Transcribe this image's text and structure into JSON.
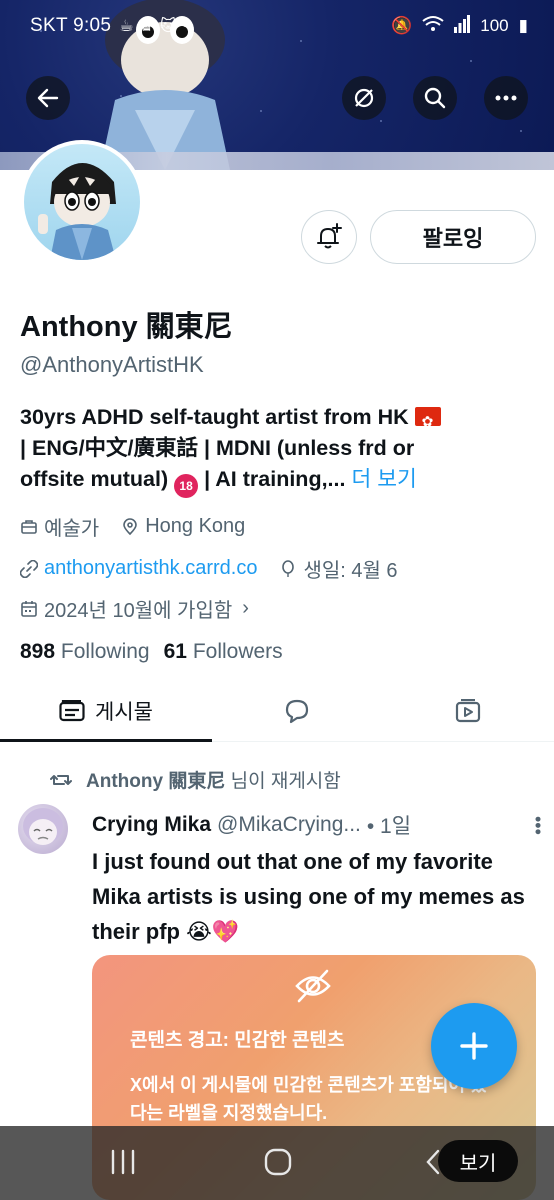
{
  "status_bar": {
    "time": "SKT 9:05",
    "battery": "100"
  },
  "profile": {
    "name": "Anthony 關東尼",
    "handle": "@AnthonyArtistHK",
    "bio_line1": "30yrs ADHD self-taught artist from HK",
    "bio_line2": "| ENG/中文/廣東話 | MDNI (unless frd or",
    "bio_line3": "offsite mutual)",
    "bio_line3b": "| AI training,...",
    "bio_more": "더 보기",
    "badge_18": "18",
    "category": "예술가",
    "location": "Hong Kong",
    "website": "anthonyartisthk.carrd.co",
    "birthday": "생일: 4월 6",
    "joined": "2024년 10월에 가입함",
    "following_count": "898",
    "following_label": "Following",
    "followers_count": "61",
    "followers_label": "Followers"
  },
  "buttons": {
    "following": "팔로잉"
  },
  "tabs": {
    "posts": "게시물"
  },
  "post": {
    "repost_by": "Anthony 關東尼",
    "repost_suffix": "님이 재게시함",
    "author": "Crying Mika",
    "author_handle": "@MikaCrying...",
    "time": "• 1일",
    "text": "I just found out that one of my favorite Mika artists is using one of my memes as their pfp 😭💖",
    "warning_title": "콘텐츠 경고: 민감한 콘텐츠",
    "warning_body": "X에서 이 게시물에 민감한 콘텐츠가 포함되어 있다는 라벨을 지정했습니다."
  },
  "system": {
    "view_button": "보기"
  },
  "colors": {
    "accent": "#1d9bf0",
    "text": "#0f1419",
    "muted": "#536471"
  }
}
